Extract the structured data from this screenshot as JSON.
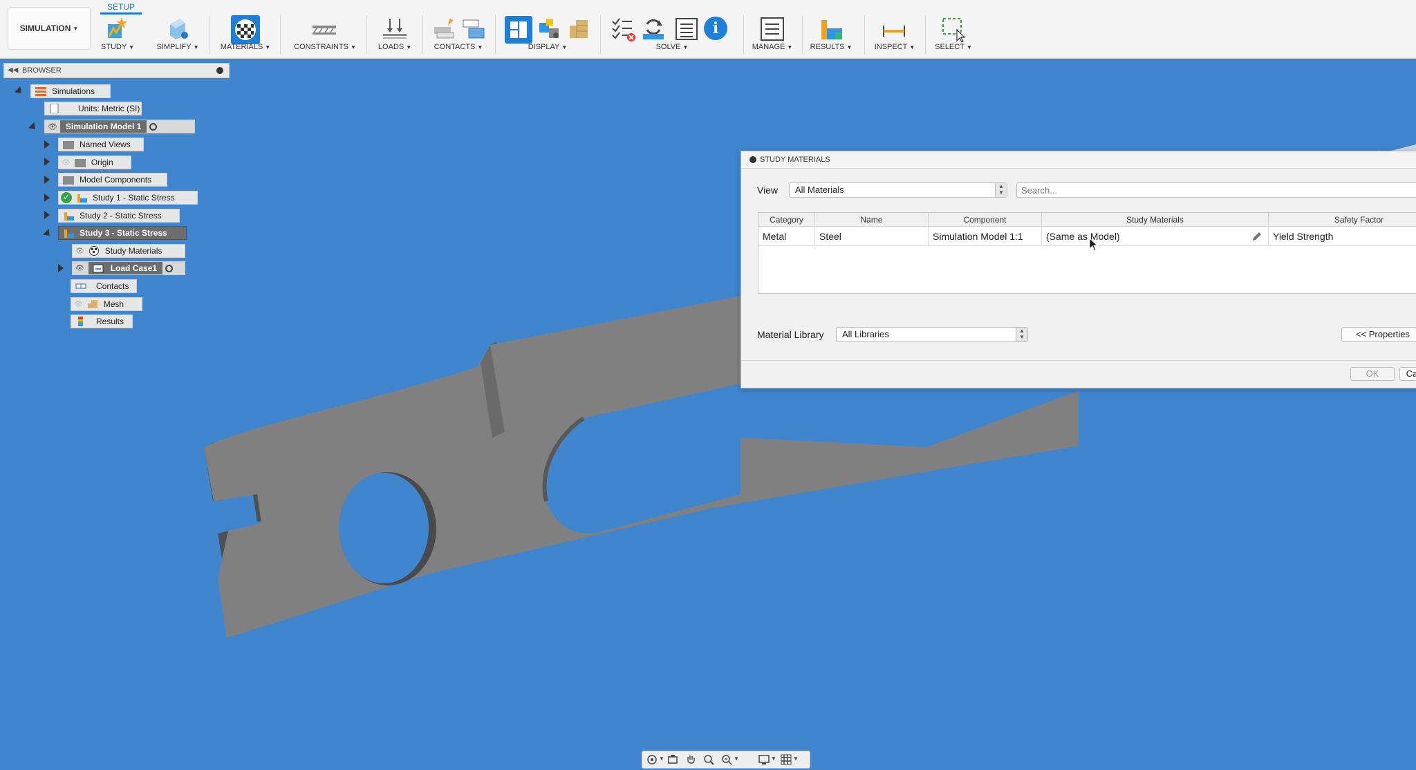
{
  "toolbar": {
    "workspace": "SIMULATION",
    "active_tab": "SETUP",
    "groups": [
      {
        "label": "STUDY"
      },
      {
        "label": "SIMPLIFY"
      },
      {
        "label": "MATERIALS"
      },
      {
        "label": "CONSTRAINTS"
      },
      {
        "label": "LOADS"
      },
      {
        "label": "CONTACTS"
      },
      {
        "label": "DISPLAY"
      },
      {
        "label": "SOLVE"
      },
      {
        "label": "MANAGE"
      },
      {
        "label": "RESULTS"
      },
      {
        "label": "INSPECT"
      },
      {
        "label": "SELECT"
      }
    ]
  },
  "browser": {
    "title": "BROWSER",
    "nodes": [
      {
        "label": "Simulations"
      },
      {
        "label": "Units: Metric (SI)"
      },
      {
        "label": "Simulation Model 1"
      },
      {
        "label": "Named Views"
      },
      {
        "label": "Origin"
      },
      {
        "label": "Model Components"
      },
      {
        "label": "Study 1 - Static Stress"
      },
      {
        "label": "Study 2 - Static Stress"
      },
      {
        "label": "Study 3 - Static Stress"
      },
      {
        "label": "Study Materials"
      },
      {
        "label": "Load Case1"
      },
      {
        "label": "Contacts"
      },
      {
        "label": "Mesh"
      },
      {
        "label": "Results"
      }
    ]
  },
  "dialog": {
    "title": "STUDY MATERIALS",
    "view_label": "View",
    "view_value": "All Materials",
    "search_placeholder": "Search...",
    "columns": [
      "Category",
      "Name",
      "Component",
      "Study Materials",
      "Safety Factor"
    ],
    "rows": [
      {
        "category": "Metal",
        "name": "Steel",
        "component": "Simulation Model 1:1",
        "study_material": "(Same as Model)",
        "safety_factor": "Yield Strength"
      }
    ],
    "library_label": "Material Library",
    "library_value": "All Libraries",
    "properties_button": "<< Properties",
    "ok_button": "OK",
    "cancel_button": "Ca"
  },
  "colors": {
    "viewport_bg": "#3f86cf",
    "part_fill": "#7f7f7f",
    "accent": "#1e7fd8"
  }
}
